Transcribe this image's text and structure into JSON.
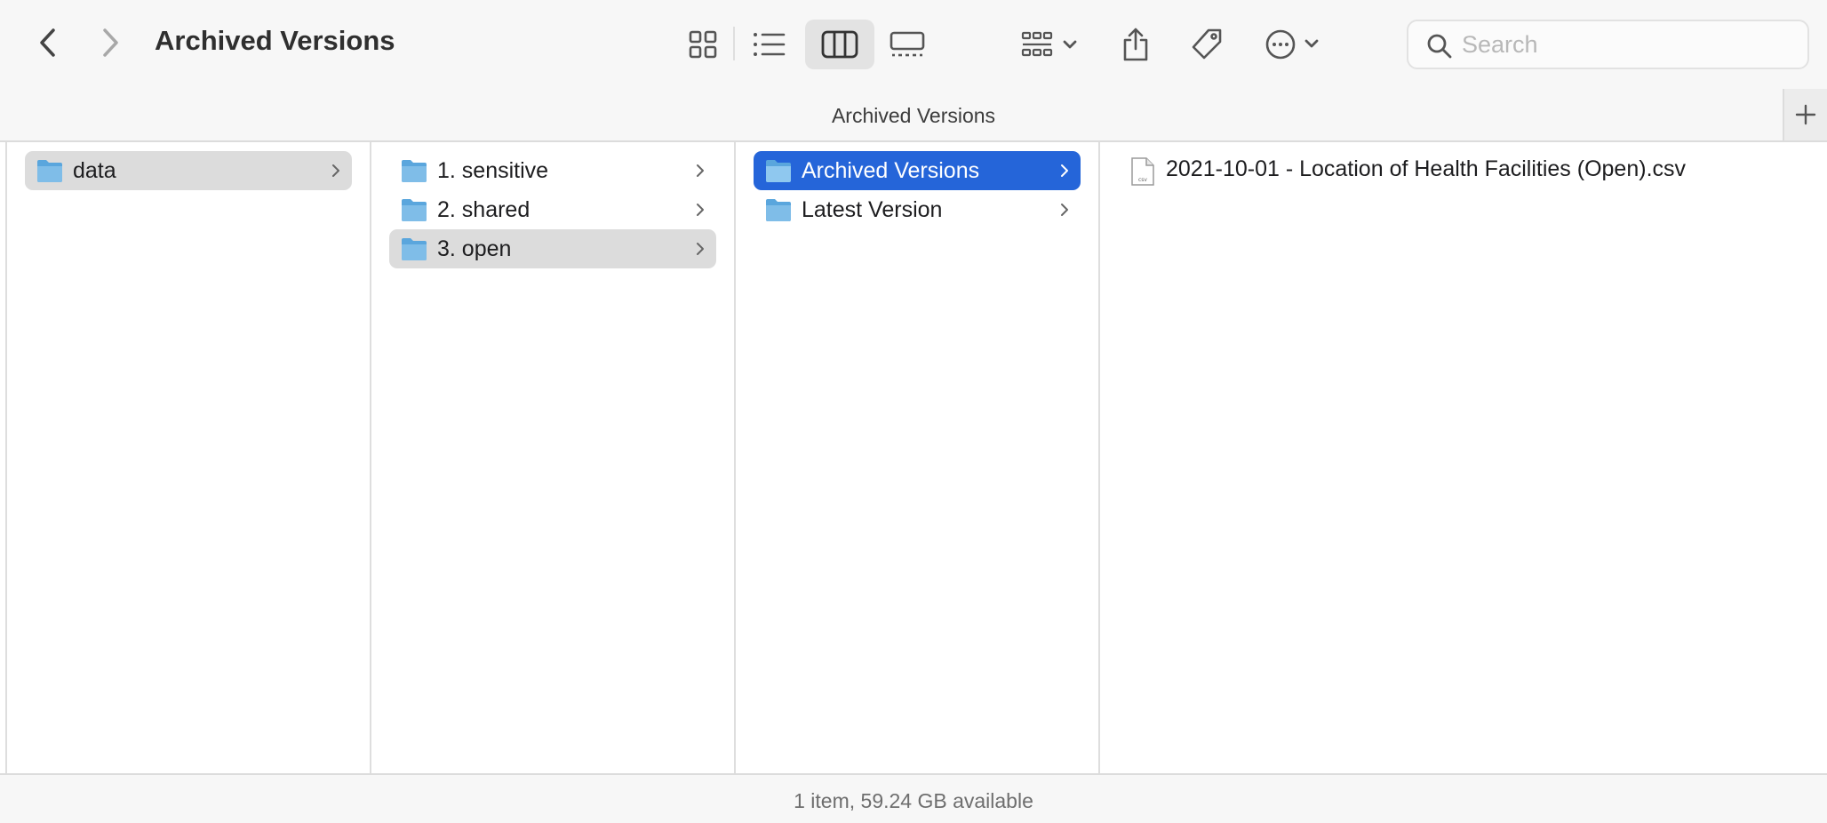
{
  "window": {
    "title": "Archived Versions"
  },
  "toolbar": {
    "back_icon": "chevron-left-icon",
    "forward_icon": "chevron-right-icon",
    "view_buttons": [
      "icon-view",
      "list-view",
      "column-view",
      "gallery-view"
    ],
    "active_view": "column-view",
    "group_icon": "group-icon",
    "share_icon": "share-icon",
    "tag_icon": "tag-icon",
    "more_icon": "more-actions-icon"
  },
  "search": {
    "placeholder": "Search",
    "value": ""
  },
  "pathbar": {
    "title": "Archived Versions"
  },
  "columns": [
    {
      "items": [
        {
          "label": "data",
          "type": "folder",
          "selected": "gray",
          "has_children": true
        }
      ]
    },
    {
      "items": [
        {
          "label": "1. sensitive",
          "type": "folder",
          "selected": "none",
          "has_children": true
        },
        {
          "label": "2. shared",
          "type": "folder",
          "selected": "none",
          "has_children": true
        },
        {
          "label": "3. open",
          "type": "folder",
          "selected": "gray",
          "has_children": true
        }
      ]
    },
    {
      "items": [
        {
          "label": "Archived Versions",
          "type": "folder",
          "selected": "blue",
          "has_children": true
        },
        {
          "label": "Latest Version",
          "type": "folder",
          "selected": "none",
          "has_children": true
        }
      ]
    },
    {
      "items": [
        {
          "label": "2021-10-01 - Location of Health Facilities (Open).csv",
          "type": "file",
          "file_badge": "csv"
        }
      ]
    }
  ],
  "status": {
    "text": "1 item, 59.24 GB available"
  },
  "colors": {
    "selection_blue": "#2565d9",
    "selection_gray": "#dcdcdc",
    "folder_blue": "#7fbde8"
  }
}
